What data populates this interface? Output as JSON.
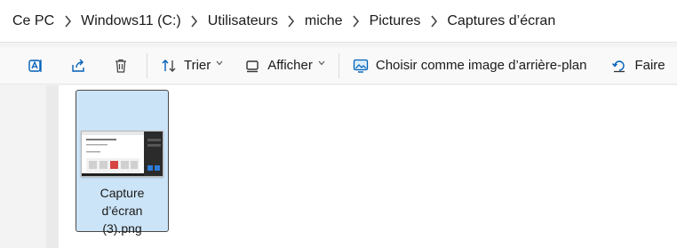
{
  "breadcrumb": {
    "items": [
      "Ce PC",
      "Windows11 (C:)",
      "Utilisateurs",
      "miche",
      "Pictures",
      "Captures d’écran"
    ]
  },
  "toolbar": {
    "icons": [
      "rename-icon",
      "share-icon",
      "delete-icon"
    ],
    "sort_label": "Trier",
    "view_label": "Afficher",
    "set_background_label": "Choisir comme image d’arrière-plan",
    "rotate_label": "Faire"
  },
  "files": [
    {
      "name_lines": [
        "Capture",
        "d’écran",
        "(3).png"
      ],
      "selected": true
    }
  ],
  "colors": {
    "selection": "#cce4f7",
    "accent": "#005fb8"
  }
}
